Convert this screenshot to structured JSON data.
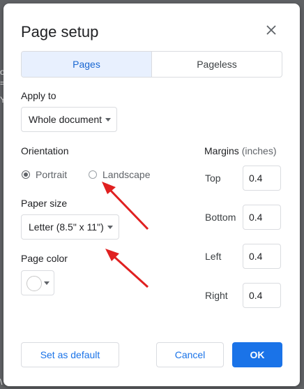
{
  "dialog": {
    "title": "Page setup",
    "tabs": [
      {
        "label": "Pages",
        "active": true
      },
      {
        "label": "Pageless",
        "active": false
      }
    ],
    "apply_to": {
      "label": "Apply to",
      "value": "Whole document"
    },
    "orientation": {
      "label": "Orientation",
      "options": [
        {
          "label": "Portrait",
          "checked": true
        },
        {
          "label": "Landscape",
          "checked": false
        }
      ]
    },
    "paper_size": {
      "label": "Paper size",
      "value": "Letter (8.5\" x 11\")"
    },
    "page_color": {
      "label": "Page color",
      "value": "#ffffff"
    },
    "margins": {
      "label": "Margins",
      "unit": "(inches)",
      "top": {
        "label": "Top",
        "value": "0.4"
      },
      "bottom": {
        "label": "Bottom",
        "value": "0.4"
      },
      "left": {
        "label": "Left",
        "value": "0.4"
      },
      "right": {
        "label": "Right",
        "value": "0.4"
      }
    },
    "buttons": {
      "set_default": "Set as default",
      "cancel": "Cancel",
      "ok": "OK"
    }
  },
  "colors": {
    "accent": "#1a73e8",
    "active_tab_bg": "#e8f0fe",
    "annotation_arrow": "#e02020"
  },
  "icons": {
    "close": "close-icon",
    "dropdown": "chevron-down-icon"
  }
}
